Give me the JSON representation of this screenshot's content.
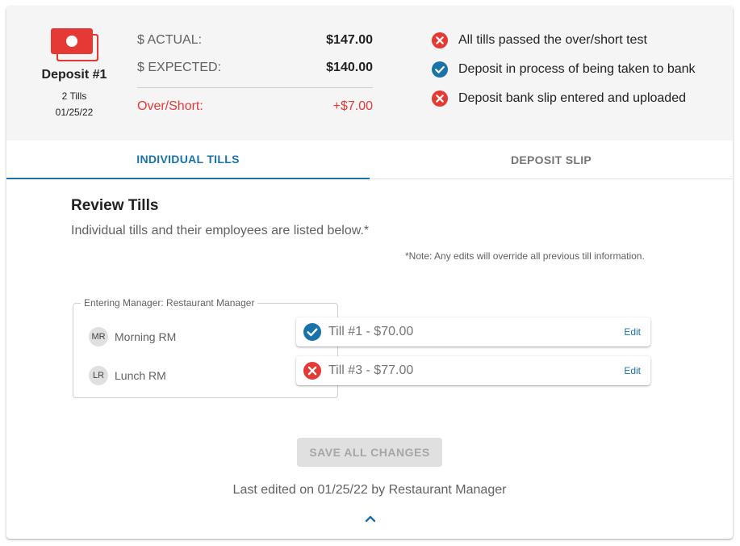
{
  "deposit": {
    "title": "Deposit #1",
    "tills_count": "2 Tills",
    "date": "01/25/22"
  },
  "amounts": {
    "actual_label": "$ ACTUAL:",
    "actual_value": "$147.00",
    "expected_label": "$ EXPECTED:",
    "expected_value": "$140.00",
    "overshort_label": "Over/Short:",
    "overshort_value": "+$7.00"
  },
  "statuses": [
    {
      "text": "All tills passed the over/short test",
      "state": "fail"
    },
    {
      "text": "Deposit in process of being taken to bank",
      "state": "pass"
    },
    {
      "text": "Deposit bank slip entered and uploaded",
      "state": "fail"
    }
  ],
  "tabs": [
    {
      "label": "INDIVIDUAL TILLS",
      "active": true
    },
    {
      "label": "DEPOSIT SLIP",
      "active": false
    }
  ],
  "review": {
    "title": "Review Tills",
    "subtitle": "Individual tills and their employees are listed below.*",
    "note": "*Note: Any edits will override all previous till information."
  },
  "manager": {
    "legend": "Entering Manager: Restaurant Manager",
    "employees": [
      {
        "initials": "MR",
        "name": "Morning RM"
      },
      {
        "initials": "LR",
        "name": "Lunch RM"
      }
    ]
  },
  "tills": [
    {
      "label": "Till #1 - $70.00",
      "state": "pass",
      "edit_label": "Edit"
    },
    {
      "label": "Till #3 - $77.00",
      "state": "fail",
      "edit_label": "Edit"
    }
  ],
  "footer": {
    "save_label": "SAVE ALL CHANGES",
    "last_edited": "Last edited on 01/25/22 by Restaurant Manager"
  },
  "colors": {
    "accent": "#1a73a8",
    "error": "#e53935",
    "summary_bg": "#f5f5f5",
    "disabled_btn": "#e0e0e0"
  },
  "icons": {
    "deposit": "cash-stack-icon",
    "pass": "check-circle-icon",
    "fail": "x-circle-icon",
    "collapse": "chevron-up-icon"
  }
}
